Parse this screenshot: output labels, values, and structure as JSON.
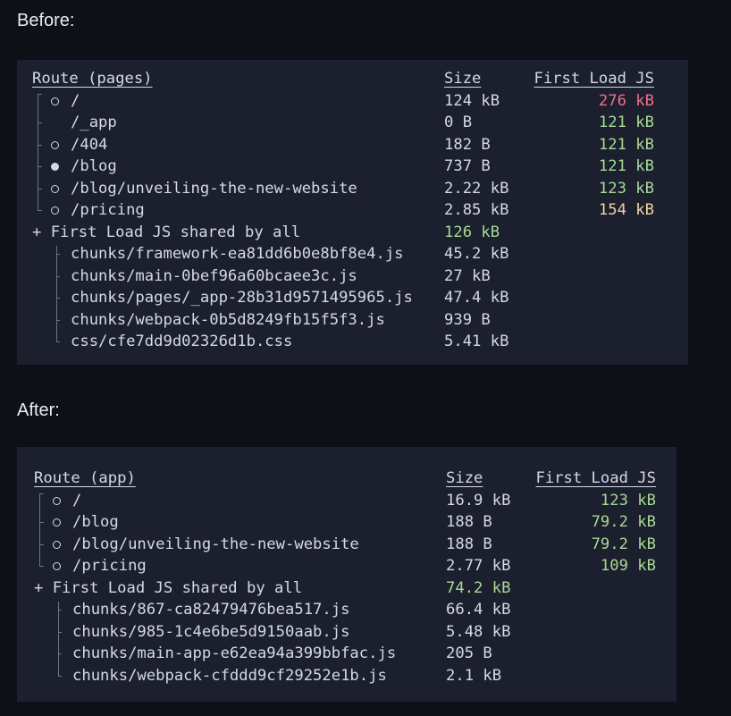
{
  "before": {
    "heading": "Before:",
    "header": {
      "route": "Route (pages)",
      "size": "Size",
      "first_load": "First Load JS"
    },
    "routes": [
      {
        "route": "/",
        "size": "124 kB",
        "first_load": "276 kB",
        "marker": "open",
        "color": "#ee6f88"
      },
      {
        "route": "/_app",
        "size": "0 B",
        "first_load": "121 kB",
        "marker": "none",
        "color": "#a6da95"
      },
      {
        "route": "/404",
        "size": "182 B",
        "first_load": "121 kB",
        "marker": "open",
        "color": "#a6da95"
      },
      {
        "route": "/blog",
        "size": "737 B",
        "first_load": "121 kB",
        "marker": "filled",
        "color": "#a6da95"
      },
      {
        "route": "/blog/unveiling-the-new-website",
        "size": "2.22 kB",
        "first_load": "123 kB",
        "marker": "open",
        "color": "#a6da95"
      },
      {
        "route": "/pricing",
        "size": "2.85 kB",
        "first_load": "154 kB",
        "marker": "open",
        "color": "#eed49f"
      }
    ],
    "shared": {
      "label": "+ First Load JS shared by all",
      "size": "126 kB"
    },
    "chunks": [
      {
        "name": "chunks/framework-ea81dd6b0e8bf8e4.js",
        "size": "45.2 kB"
      },
      {
        "name": "chunks/main-0bef96a60bcaee3c.js",
        "size": "27 kB"
      },
      {
        "name": "chunks/pages/_app-28b31d9571495965.js",
        "size": "47.4 kB"
      },
      {
        "name": "chunks/webpack-0b5d8249fb15f5f3.js",
        "size": "939 B"
      },
      {
        "name": "css/cfe7dd9d02326d1b.css",
        "size": "5.41 kB"
      }
    ]
  },
  "after": {
    "heading": "After:",
    "header": {
      "route": "Route (app)",
      "size": "Size",
      "first_load": "First Load JS"
    },
    "routes": [
      {
        "route": "/",
        "size": "16.9 kB",
        "first_load": "123 kB",
        "marker": "open",
        "color": "#a6da95"
      },
      {
        "route": "/blog",
        "size": "188 B",
        "first_load": "79.2 kB",
        "marker": "open",
        "color": "#a6da95"
      },
      {
        "route": "/blog/unveiling-the-new-website",
        "size": "188 B",
        "first_load": "79.2 kB",
        "marker": "open",
        "color": "#a6da95"
      },
      {
        "route": "/pricing",
        "size": "2.77 kB",
        "first_load": "109 kB",
        "marker": "open",
        "color": "#a6da95"
      }
    ],
    "shared": {
      "label": "+ First Load JS shared by all",
      "size": "74.2 kB"
    },
    "chunks": [
      {
        "name": "chunks/867-ca82479476bea517.js",
        "size": "66.4 kB"
      },
      {
        "name": "chunks/985-1c4e6be5d9150aab.js",
        "size": "5.48 kB"
      },
      {
        "name": "chunks/main-app-e62ea94a399bbfac.js",
        "size": "205 B"
      },
      {
        "name": "chunks/webpack-cfddd9cf29252e1b.js",
        "size": "2.1 kB"
      }
    ]
  }
}
